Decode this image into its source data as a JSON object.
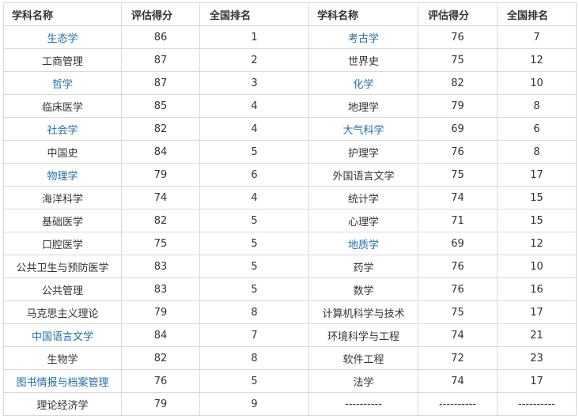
{
  "headers": [
    "学科名称",
    "评估得分",
    "全国排名",
    "学科名称",
    "评估得分",
    "全国排名"
  ],
  "rows": [
    {
      "l_name": "生态学",
      "l_link": true,
      "l_score": "86",
      "l_rank": "1",
      "r_name": "考古学",
      "r_link": true,
      "r_score": "76",
      "r_rank": "7"
    },
    {
      "l_name": "工商管理",
      "l_link": false,
      "l_score": "87",
      "l_rank": "2",
      "r_name": "世界史",
      "r_link": false,
      "r_score": "75",
      "r_rank": "12"
    },
    {
      "l_name": "哲学",
      "l_link": true,
      "l_score": "87",
      "l_rank": "3",
      "r_name": "化学",
      "r_link": true,
      "r_score": "82",
      "r_rank": "10"
    },
    {
      "l_name": "临床医学",
      "l_link": false,
      "l_score": "85",
      "l_rank": "4",
      "r_name": "地理学",
      "r_link": false,
      "r_score": "79",
      "r_rank": "8"
    },
    {
      "l_name": "社会学",
      "l_link": true,
      "l_score": "82",
      "l_rank": "4",
      "r_name": "大气科学",
      "r_link": true,
      "r_score": "69",
      "r_rank": "6"
    },
    {
      "l_name": "中国史",
      "l_link": false,
      "l_score": "84",
      "l_rank": "5",
      "r_name": "护理学",
      "r_link": false,
      "r_score": "76",
      "r_rank": "8"
    },
    {
      "l_name": "物理学",
      "l_link": true,
      "l_score": "79",
      "l_rank": "6",
      "r_name": "外国语言文学",
      "r_link": false,
      "r_score": "75",
      "r_rank": "17"
    },
    {
      "l_name": "海洋科学",
      "l_link": false,
      "l_score": "74",
      "l_rank": "4",
      "r_name": "统计学",
      "r_link": false,
      "r_score": "74",
      "r_rank": "15"
    },
    {
      "l_name": "基础医学",
      "l_link": false,
      "l_score": "82",
      "l_rank": "5",
      "r_name": "心理学",
      "r_link": false,
      "r_score": "71",
      "r_rank": "15"
    },
    {
      "l_name": "口腔医学",
      "l_link": false,
      "l_score": "75",
      "l_rank": "5",
      "r_name": "地质学",
      "r_link": true,
      "r_score": "69",
      "r_rank": "12"
    },
    {
      "l_name": "公共卫生与预防医学",
      "l_link": false,
      "l_score": "83",
      "l_rank": "5",
      "r_name": "药学",
      "r_link": false,
      "r_score": "76",
      "r_rank": "10"
    },
    {
      "l_name": "公共管理",
      "l_link": false,
      "l_score": "83",
      "l_rank": "5",
      "r_name": "数学",
      "r_link": false,
      "r_score": "76",
      "r_rank": "16"
    },
    {
      "l_name": "马克思主义理论",
      "l_link": false,
      "l_score": "79",
      "l_rank": "8",
      "r_name": "计算机科学与技术",
      "r_link": false,
      "r_score": "75",
      "r_rank": "17"
    },
    {
      "l_name": "中国语言文学",
      "l_link": true,
      "l_score": "84",
      "l_rank": "7",
      "r_name": "环境科学与工程",
      "r_link": false,
      "r_score": "74",
      "r_rank": "21"
    },
    {
      "l_name": "生物学",
      "l_link": false,
      "l_score": "82",
      "l_rank": "8",
      "r_name": "软件工程",
      "r_link": false,
      "r_score": "72",
      "r_rank": "23"
    },
    {
      "l_name": "图书情报与档案管理",
      "l_link": true,
      "l_score": "76",
      "l_rank": "5",
      "r_name": "法学",
      "r_link": false,
      "r_score": "74",
      "r_rank": "17"
    },
    {
      "l_name": "理论经济学",
      "l_link": false,
      "l_score": "79",
      "l_rank": "9",
      "r_name": "----------",
      "r_link": false,
      "r_score": "----------",
      "r_rank": "----------"
    }
  ],
  "colors": {
    "link": "#1f6fa8",
    "text": "#333333",
    "border": "#d9d9d9"
  }
}
